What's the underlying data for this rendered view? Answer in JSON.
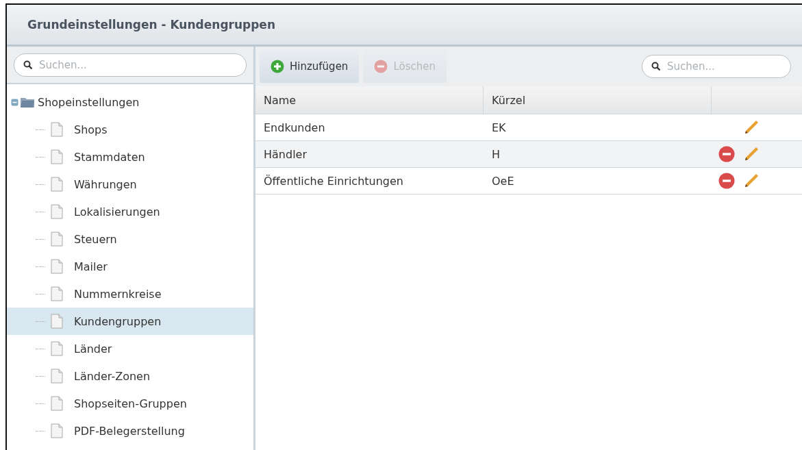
{
  "window": {
    "title": "Grundeinstellungen - Kundengruppen"
  },
  "sidebar": {
    "search": {
      "placeholder": "Suchen..."
    },
    "tree": [
      {
        "label": "Shopeinstellungen",
        "expanded": true,
        "children": [
          {
            "label": "Shops",
            "selected": false
          },
          {
            "label": "Stammdaten",
            "selected": false
          },
          {
            "label": "Währungen",
            "selected": false
          },
          {
            "label": "Lokalisierungen",
            "selected": false
          },
          {
            "label": "Steuern",
            "selected": false
          },
          {
            "label": "Mailer",
            "selected": false
          },
          {
            "label": "Nummernkreise",
            "selected": false
          },
          {
            "label": "Kundengruppen",
            "selected": true
          },
          {
            "label": "Länder",
            "selected": false
          },
          {
            "label": "Länder-Zonen",
            "selected": false
          },
          {
            "label": "Shopseiten-Gruppen",
            "selected": false
          },
          {
            "label": "PDF-Belegerstellung",
            "selected": false
          }
        ]
      }
    ]
  },
  "toolbar": {
    "buttons": [
      {
        "label": "Hinzufügen",
        "kind": "add",
        "disabled": false
      },
      {
        "label": "Löschen",
        "kind": "delete",
        "disabled": true
      }
    ],
    "search": {
      "placeholder": "Suchen..."
    }
  },
  "table": {
    "columns": [
      "Name",
      "Kürzel"
    ],
    "rows": [
      {
        "name": "Endkunden",
        "short": "EK",
        "deletable": false
      },
      {
        "name": "Händler",
        "short": "H",
        "deletable": true
      },
      {
        "name": "Öffentliche Einrichtungen",
        "short": "OeE",
        "deletable": true
      }
    ]
  }
}
